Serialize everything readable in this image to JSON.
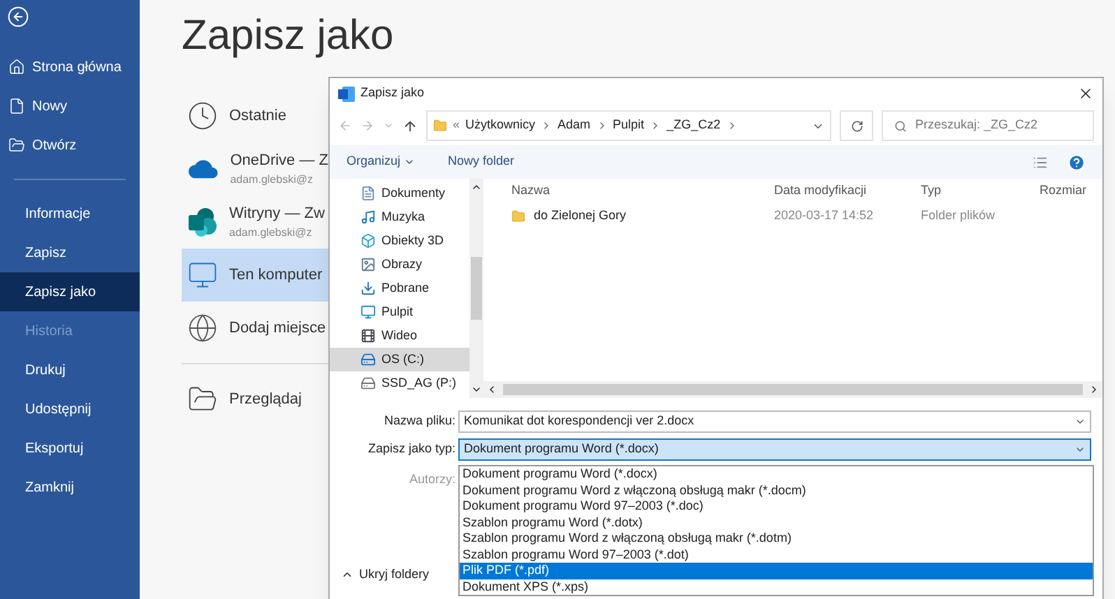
{
  "sidebar": {
    "items": [
      {
        "label": "Strona główna",
        "selected": false,
        "disabled": false
      },
      {
        "label": "Nowy",
        "selected": false,
        "disabled": false
      },
      {
        "label": "Otwórz",
        "selected": false,
        "disabled": false
      },
      {
        "label": "Informacje",
        "selected": false,
        "disabled": false
      },
      {
        "label": "Zapisz",
        "selected": false,
        "disabled": false
      },
      {
        "label": "Zapisz jako",
        "selected": true,
        "disabled": false
      },
      {
        "label": "Historia",
        "selected": false,
        "disabled": true
      },
      {
        "label": "Drukuj",
        "selected": false,
        "disabled": false
      },
      {
        "label": "Udostępnij",
        "selected": false,
        "disabled": false
      },
      {
        "label": "Eksportuj",
        "selected": false,
        "disabled": false
      },
      {
        "label": "Zamknij",
        "selected": false,
        "disabled": false
      }
    ]
  },
  "page_title": "Zapisz jako",
  "locations": [
    {
      "label": "Ostatnie",
      "selected": false
    },
    {
      "label": "OneDrive — Z",
      "sublabel": "adam.glebski@z",
      "selected": false
    },
    {
      "label": "Witryny — Zw",
      "sublabel": "adam.glebski@z",
      "selected": false
    },
    {
      "label": "Ten komputer",
      "selected": true
    },
    {
      "label": "Dodaj miejsce",
      "selected": false
    },
    {
      "label": "Przeglądaj",
      "selected": false
    }
  ],
  "dialog": {
    "title": "Zapisz jako",
    "address": {
      "overflow_marker": "«",
      "crumbs": [
        "Użytkownicy",
        "Adam",
        "Pulpit",
        "_ZG_Cz2"
      ]
    },
    "search": {
      "placeholder": "Przeszukaj: _ZG_Cz2"
    },
    "toolbar": [
      "Organizuj",
      "Nowy folder"
    ],
    "nav_items": [
      {
        "label": "Dokumenty",
        "selected": false
      },
      {
        "label": "Muzyka",
        "selected": false
      },
      {
        "label": "Obiekty 3D",
        "selected": false
      },
      {
        "label": "Obrazy",
        "selected": false
      },
      {
        "label": "Pobrane",
        "selected": false
      },
      {
        "label": "Pulpit",
        "selected": false
      },
      {
        "label": "Wideo",
        "selected": false
      },
      {
        "label": "OS (C:)",
        "selected": true
      },
      {
        "label": "SSD_AG (P:)",
        "selected": false
      }
    ],
    "columns": [
      "Nazwa",
      "Data modyfikacji",
      "Typ",
      "Rozmiar"
    ],
    "rows": [
      {
        "name": "do Zielonej Gory",
        "modified": "2020-03-17 14:52",
        "type": "Folder plików"
      }
    ],
    "file_name": {
      "label": "Nazwa pliku:",
      "value": "Komunikat dot korespondencji ver 2.docx"
    },
    "file_type": {
      "label": "Zapisz jako typ:",
      "value": "Dokument programu Word (*.docx)",
      "expanded": true
    },
    "type_options": [
      {
        "label": "Dokument programu Word (*.docx)",
        "selected": false
      },
      {
        "label": "Dokument programu Word z włączoną obsługą makr (*.docm)",
        "selected": false
      },
      {
        "label": "Dokument programu Word 97–2003 (*.doc)",
        "selected": false
      },
      {
        "label": "Szablon programu Word (*.dotx)",
        "selected": false
      },
      {
        "label": "Szablon programu Word z włączoną obsługą makr (*.dotm)",
        "selected": false
      },
      {
        "label": "Szablon programu Word 97–2003 (*.dot)",
        "selected": false
      },
      {
        "label": "Plik PDF (*.pdf)",
        "selected": true
      },
      {
        "label": "Dokument XPS (*.xps)",
        "selected": false
      }
    ],
    "authors_label": "Autorzy:",
    "hide_folders": "Ukryj foldery"
  }
}
